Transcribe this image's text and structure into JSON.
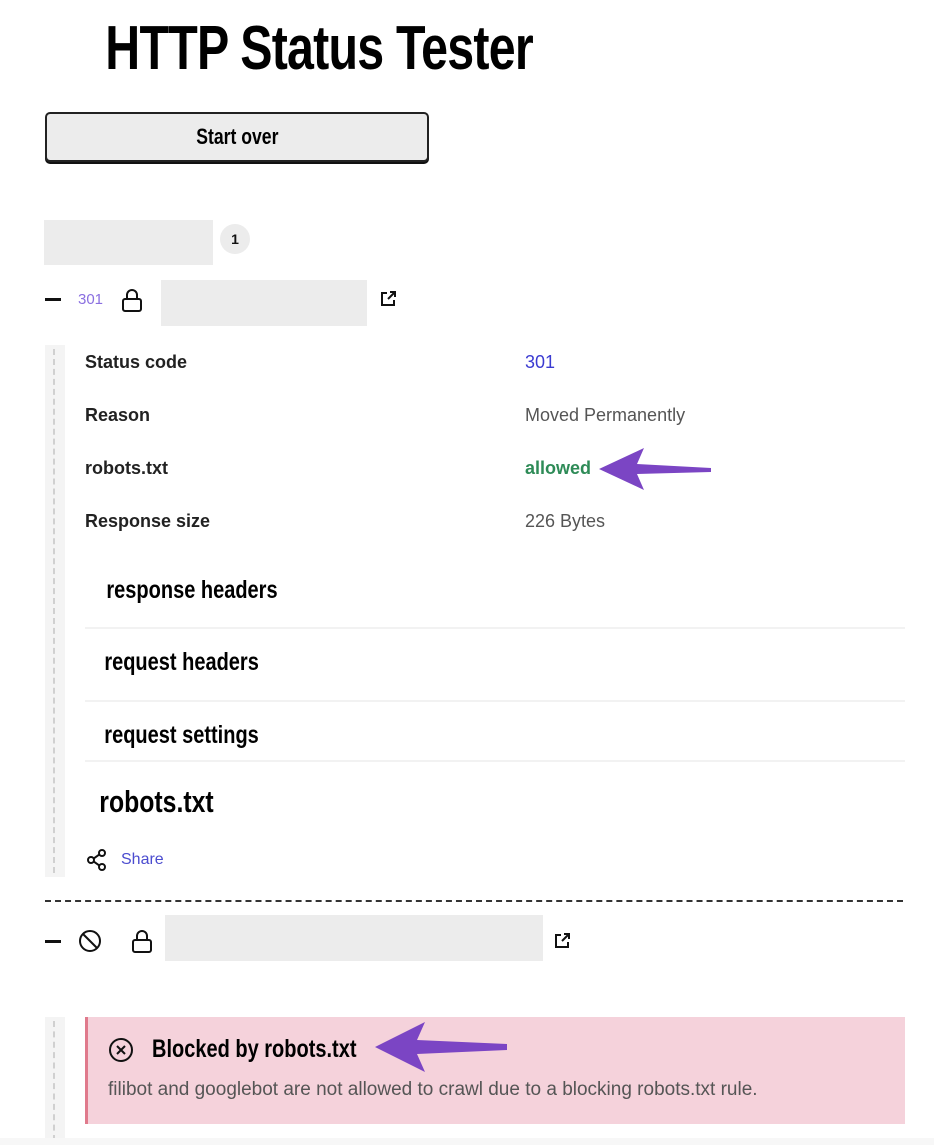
{
  "header": {
    "title": "HTTP Status Tester"
  },
  "toolbar": {
    "start_over_label": "Start over"
  },
  "results": {
    "count_badge": "1",
    "entries": [
      {
        "status_code_badge": "301",
        "details": [
          {
            "label": "Status code",
            "value": "301",
            "value_color": "#3b3bd1"
          },
          {
            "label": "Reason",
            "value": "Moved Permanently",
            "value_color": "#555555"
          },
          {
            "label": "robots.txt",
            "value": "allowed",
            "value_color": "#2e8b57"
          },
          {
            "label": "Response size",
            "value": "226 Bytes",
            "value_color": "#555555"
          }
        ],
        "sections": [
          "response headers",
          "request headers",
          "request settings",
          "robots.txt"
        ],
        "share_label": "Share"
      },
      {
        "status_icon": "blocked-icon",
        "alert": {
          "title": "Blocked by robots.txt",
          "message": "filibot and googlebot are not allowed to crawl due to a blocking robots.txt rule.",
          "background": "#f5d2db",
          "accent": "#e07a8c"
        }
      }
    ]
  },
  "annotations": {
    "arrow_color": "#7b45c4"
  }
}
